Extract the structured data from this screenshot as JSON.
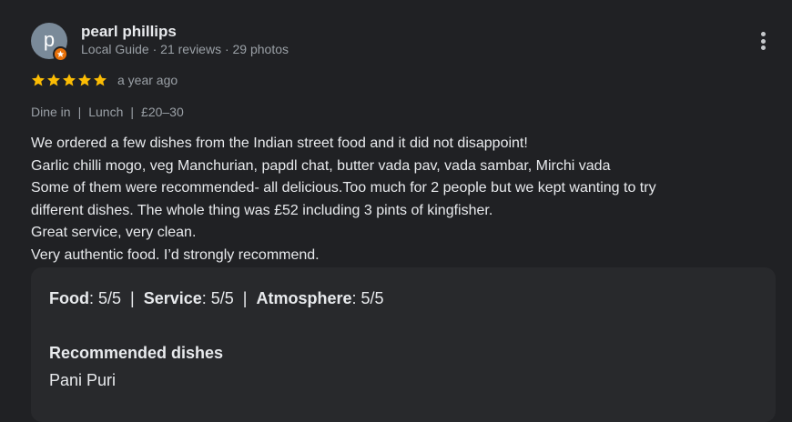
{
  "author": {
    "initial": "p",
    "name": "pearl phillips",
    "meta": "Local Guide · 21 reviews · 29 photos"
  },
  "review": {
    "rating": 5,
    "time_ago": "a year ago",
    "attributes": [
      "Dine in",
      "Lunch",
      "£20–30"
    ],
    "lines": [
      "We ordered a few dishes from the Indian street food and it did not disappoint!",
      "Garlic chilli mogo, veg Manchurian, papdl chat, butter vada pav, vada sambar, Mirchi vada",
      "Some of them were recommended- all delicious.Too much for 2 people but we kept wanting to try",
      "different dishes. The whole thing was £52 including 3 pints of kingfisher.",
      "Great service, very clean.",
      "Very authentic food. I’d strongly recommend."
    ]
  },
  "details": {
    "food_label": "Food",
    "food_value": ": 5/5",
    "service_label": "Service",
    "service_value": ": 5/5",
    "atmosphere_label": "Atmosphere",
    "atmosphere_value": ": 5/5",
    "separator": "|",
    "recommended_heading": "Recommended dishes",
    "recommended_dish": "Pani Puri"
  },
  "colors": {
    "background": "#202124",
    "star": "#fbbc04",
    "badge": "#e8710a",
    "avatar": "#7a8a99",
    "card": "#28292c"
  }
}
